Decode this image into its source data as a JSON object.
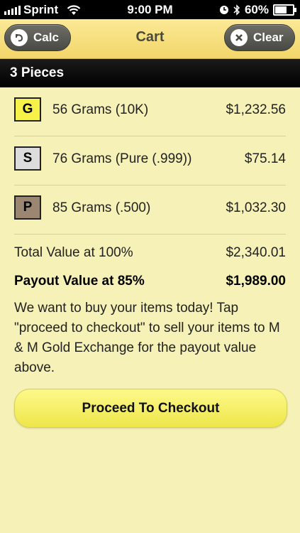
{
  "status_bar": {
    "carrier": "Sprint",
    "time": "9:00 PM",
    "battery": "60%",
    "battery_level": 0.6,
    "icons": [
      "signal-icon",
      "wifi-icon",
      "clock-icon",
      "bluetooth-icon",
      "battery-icon"
    ]
  },
  "nav": {
    "title": "Cart",
    "calc_label": "Calc",
    "clear_label": "Clear"
  },
  "section": {
    "header": "3 Pieces"
  },
  "items": [
    {
      "badge": "G",
      "badge_color": "#f7f24a",
      "description": "56 Grams (10K)",
      "price": "$1,232.56"
    },
    {
      "badge": "S",
      "badge_color": "#dcdcdc",
      "description": "76 Grams (Pure (.999))",
      "price": "$75.14"
    },
    {
      "badge": "P",
      "badge_color": "#9a8671",
      "description": "85 Grams (.500)",
      "price": "$1,032.30"
    }
  ],
  "totals": {
    "total_label": "Total Value at 100%",
    "total_value": "$2,340.01",
    "payout_label": "Payout Value at 85%",
    "payout_value": "$1,989.00"
  },
  "message": "We want to buy your items today! Tap \"proceed to checkout\" to sell your items to M & M Gold Exchange for the payout value above.",
  "checkout_button": "Proceed To Checkout",
  "colors": {
    "background": "#f6f1b6",
    "nav_bar": "#f3d66a",
    "checkout_button": "#f4ee6a"
  }
}
